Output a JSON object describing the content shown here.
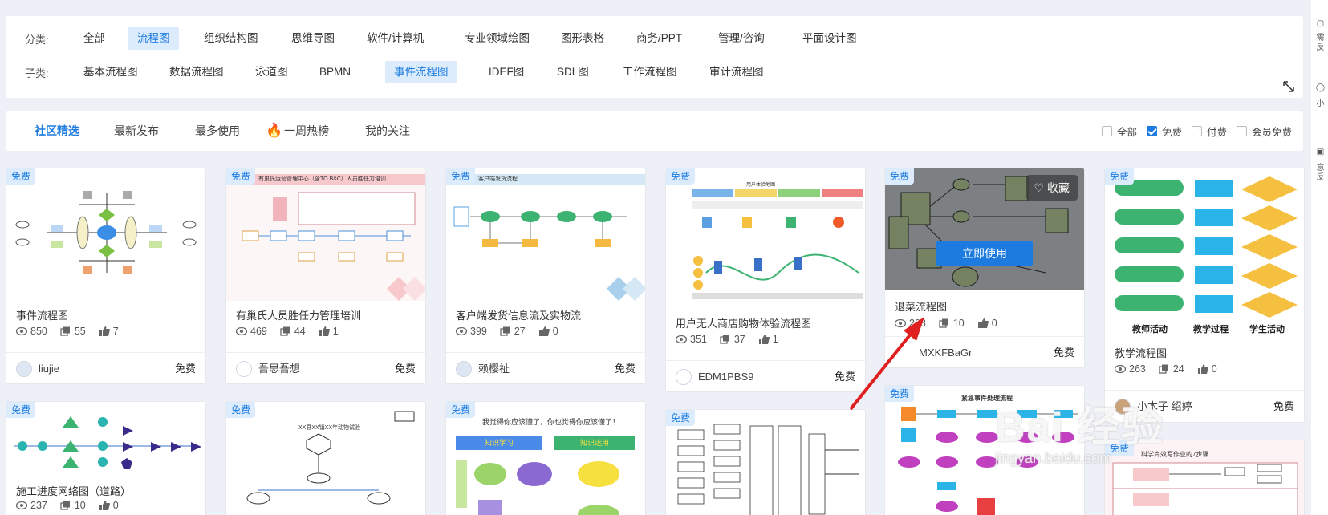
{
  "filters": {
    "category_label": "分类:",
    "categories": [
      "全部",
      "流程图",
      "组织结构图",
      "思维导图",
      "软件/计算机",
      "专业领域绘图",
      "图形表格",
      "商务/PPT",
      "管理/咨询",
      "平面设计图"
    ],
    "active_category": "流程图",
    "subcategory_label": "子类:",
    "subcategories": [
      "基本流程图",
      "数据流程图",
      "泳道图",
      "BPMN",
      "事件流程图",
      "IDEF图",
      "SDL图",
      "工作流程图",
      "审计流程图"
    ],
    "active_subcategory": "事件流程图",
    "expand_icon": "expand-arrows-icon"
  },
  "tabs": {
    "items": [
      "社区精选",
      "最新发布",
      "最多使用",
      "一周热榜",
      "我的关注"
    ],
    "active": "社区精选",
    "hot_icon": "fire-icon"
  },
  "price_filters": [
    {
      "label": "全部",
      "checked": false
    },
    {
      "label": "免费",
      "checked": true
    },
    {
      "label": "付费",
      "checked": false
    },
    {
      "label": "会员免费",
      "checked": false
    }
  ],
  "cards": [
    {
      "badge": "免费",
      "title": "事件流程图",
      "views": "850",
      "comments": "55",
      "likes": "7",
      "author": "liujie",
      "price": "免费"
    },
    {
      "badge": "免费",
      "title": "有巢氏人员胜任力管理培训",
      "views": "469",
      "comments": "44",
      "likes": "1",
      "author": "吾思吾想",
      "price": "免费",
      "thumb_heading": "有巢氏运营管理中心（含TO B&C）人员胜任力培训"
    },
    {
      "badge": "免费",
      "title": "客户端发货信息流及实物流",
      "views": "399",
      "comments": "27",
      "likes": "0",
      "author": "赖樱祉",
      "price": "免费",
      "thumb_heading": "客户端发货流程"
    },
    {
      "badge": "免费",
      "title": "用户无人商店购物体验流程图",
      "views": "351",
      "comments": "37",
      "likes": "1",
      "author": "EDM1PBS9",
      "price": "免费",
      "thumb_heading": "用户体验地图"
    },
    {
      "badge": "免费",
      "title": "退菜流程图",
      "views": "268",
      "comments": "10",
      "likes": "0",
      "author": "MXKFBaGr",
      "price": "免费",
      "collect_label": "收藏",
      "use_label": "立即使用"
    },
    {
      "badge": "免费",
      "title": "教学流程图",
      "views": "263",
      "comments": "24",
      "likes": "0",
      "author": "小木子 绍婷",
      "price": "免费",
      "col_labels": [
        "教师活动",
        "教学过程",
        "学生活动"
      ]
    },
    {
      "badge": "免费",
      "title": "施工进度网络图（道路）",
      "views": "237",
      "comments": "10",
      "likes": "0"
    },
    {
      "badge": "免费",
      "thumb_heading": "XX县XX镇XX年动物试验"
    },
    {
      "badge": "免费",
      "thumb_heading": "我觉得你应该懂了，你也觉得你应该懂了！",
      "thumb_tags": [
        "知识学习",
        "知识运用"
      ]
    },
    {
      "badge": "免费"
    },
    {
      "badge": "免费",
      "thumb_heading": "紧急事件处理流程"
    },
    {
      "badge": "免费",
      "thumb_heading": "科学尚效写作业的7步骤"
    }
  ],
  "watermark": {
    "main": "Bai 经验",
    "sub": "jingyan.baidu.com"
  },
  "right_rail": [
    "需反",
    "小",
    "意反"
  ],
  "colors": {
    "accent": "#1d7be0",
    "accent_bg": "#dcecfc",
    "page_bg": "#eef0f7",
    "arrow": "#e02020"
  }
}
